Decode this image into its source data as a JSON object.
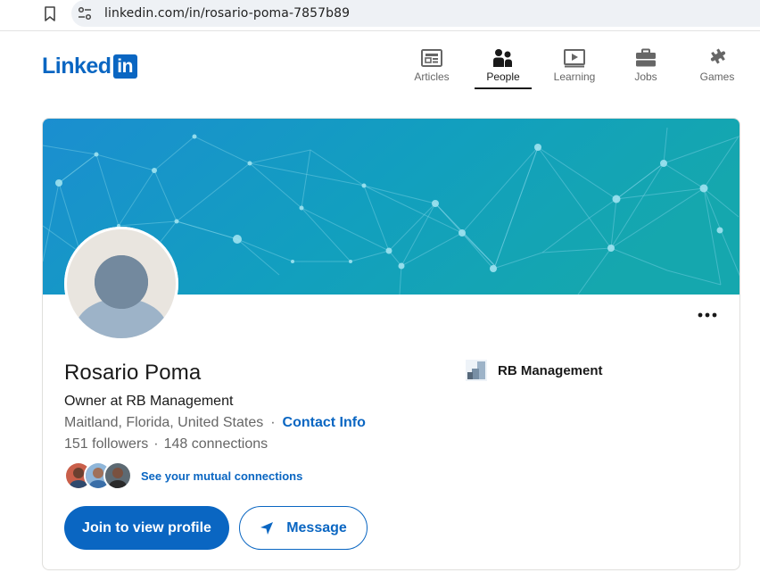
{
  "browser": {
    "url": "linkedin.com/in/rosario-poma-7857b89"
  },
  "header": {
    "logo_text": "Linked",
    "logo_box_text": "in",
    "nav": [
      {
        "label": "Articles",
        "icon": "articles-icon",
        "active": false
      },
      {
        "label": "People",
        "icon": "people-icon",
        "active": true
      },
      {
        "label": "Learning",
        "icon": "learning-icon",
        "active": false
      },
      {
        "label": "Jobs",
        "icon": "jobs-icon",
        "active": false
      },
      {
        "label": "Games",
        "icon": "games-icon",
        "active": false
      }
    ]
  },
  "profile": {
    "name": "Rosario Poma",
    "headline": "Owner at RB Management",
    "location": "Maitland, Florida, United States",
    "separator": "·",
    "contact_label": "Contact Info",
    "followers": "151 followers",
    "connections": "148 connections",
    "mutual_label": "See your mutual connections",
    "company": "RB Management",
    "primary_button": "Join to view profile",
    "secondary_button": "Message"
  },
  "colors": {
    "brand": "#0a66c2",
    "banner_start": "#1a8fd1",
    "banner_end": "#14a6b1"
  }
}
